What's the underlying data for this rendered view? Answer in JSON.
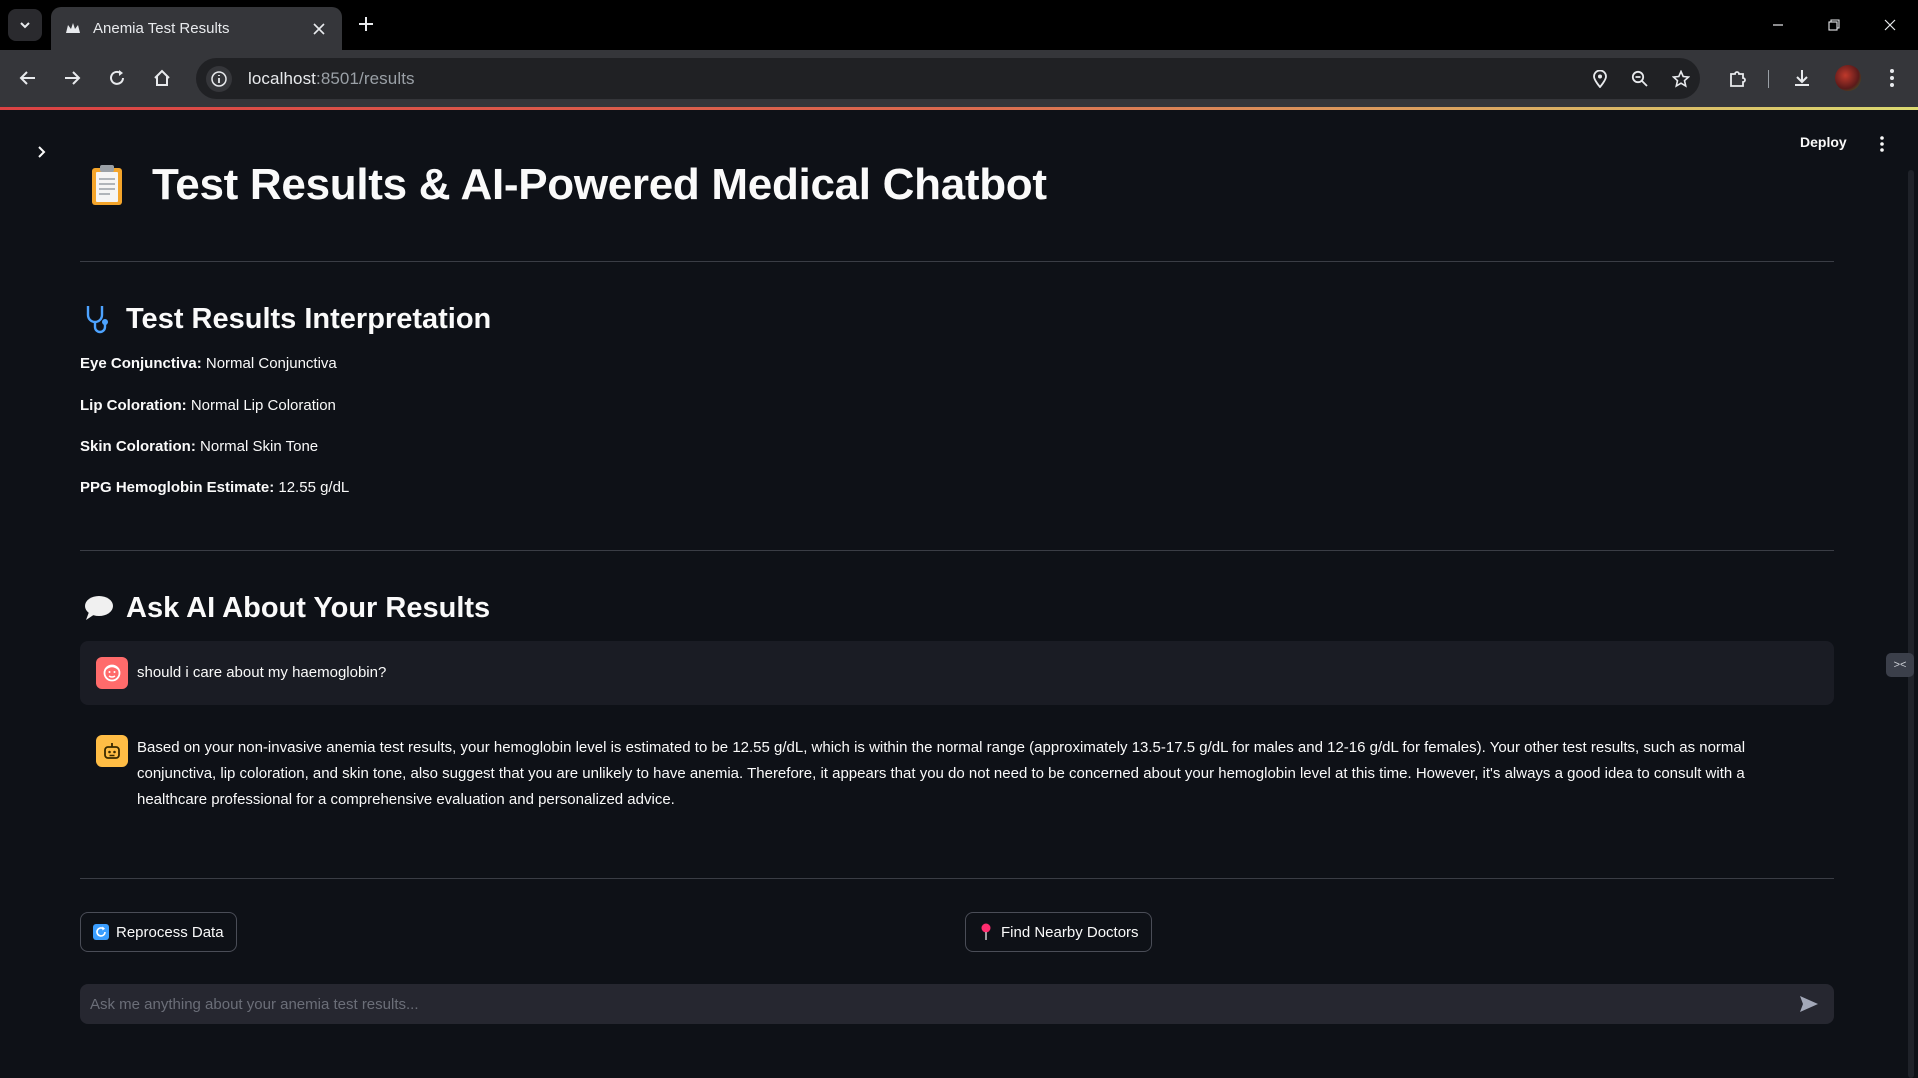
{
  "browser": {
    "tab_title": "Anemia Test Results",
    "url_host": "localhost",
    "url_rest": ":8501/results"
  },
  "app": {
    "deploy_label": "Deploy",
    "page_title": "Test Results & AI-Powered Medical Chatbot",
    "results_section": {
      "title": "Test Results Interpretation",
      "items": [
        {
          "label": "Eye Conjunctiva:",
          "value": "Normal Conjunctiva"
        },
        {
          "label": "Lip Coloration:",
          "value": "Normal Lip Coloration"
        },
        {
          "label": "Skin Coloration:",
          "value": "Normal Skin Tone"
        },
        {
          "label": "PPG Hemoglobin Estimate:",
          "value": "12.55 g/dL"
        }
      ]
    },
    "chat_section": {
      "title": "Ask AI About Your Results",
      "messages": [
        {
          "role": "user",
          "text": "should i care about my haemoglobin?"
        },
        {
          "role": "assistant",
          "text": "Based on your non-invasive anemia test results, your hemoglobin level is estimated to be 12.55 g/dL, which is within the normal range (approximately 13.5-17.5 g/dL for males and 12-16 g/dL for females). Your other test results, such as normal conjunctiva, lip coloration, and skin tone, also suggest that you are unlikely to have anemia. Therefore, it appears that you do not need to be concerned about your hemoglobin level at this time. However, it's always a good idea to consult with a healthcare professional for a comprehensive evaluation and personalized advice."
        }
      ]
    },
    "buttons": {
      "reprocess_label": "Reprocess Data",
      "doctors_label": "Find Nearby Doctors"
    },
    "chat_input": {
      "placeholder": "Ask me anything about your anemia test results..."
    },
    "colors": {
      "background": "#0e1117",
      "user_avatar": "#ff6b6b",
      "ai_avatar": "#ffbd45",
      "accent": "#ff4b4b"
    }
  }
}
